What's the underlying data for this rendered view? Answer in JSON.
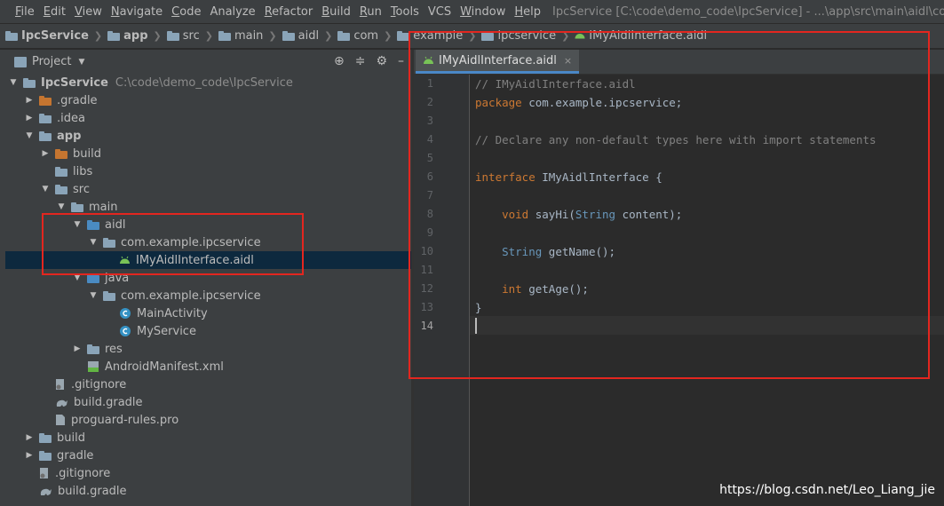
{
  "menubar": {
    "items": [
      {
        "label": "File",
        "mnemonic": "F",
        "rest": "ile"
      },
      {
        "label": "Edit",
        "mnemonic": "E",
        "rest": "dit"
      },
      {
        "label": "View",
        "mnemonic": "V",
        "rest": "iew"
      },
      {
        "label": "Navigate",
        "mnemonic": "N",
        "rest": "avigate"
      },
      {
        "label": "Code",
        "mnemonic": "C",
        "rest": "ode"
      },
      {
        "label": "Analyze",
        "mnemonic": "",
        "rest": "Analyze"
      },
      {
        "label": "Refactor",
        "mnemonic": "R",
        "rest": "efactor"
      },
      {
        "label": "Build",
        "mnemonic": "B",
        "rest": "uild"
      },
      {
        "label": "Run",
        "mnemonic": "R",
        "rest": "un"
      },
      {
        "label": "Tools",
        "mnemonic": "T",
        "rest": "ools"
      },
      {
        "label": "VCS",
        "mnemonic": "",
        "rest": "VCS"
      },
      {
        "label": "Window",
        "mnemonic": "W",
        "rest": "indow"
      },
      {
        "label": "Help",
        "mnemonic": "H",
        "rest": "elp"
      }
    ],
    "window_title": "IpcService [C:\\code\\demo_code\\IpcService] - ...\\app\\src\\main\\aidl\\com\\example"
  },
  "breadcrumbs": [
    {
      "label": "IpcService",
      "bold": true
    },
    {
      "label": "app",
      "bold": true
    },
    {
      "label": "src",
      "bold": false
    },
    {
      "label": "main",
      "bold": false
    },
    {
      "label": "aidl",
      "bold": false
    },
    {
      "label": "com",
      "bold": false
    },
    {
      "label": "example",
      "bold": false
    },
    {
      "label": "ipcservice",
      "bold": false
    },
    {
      "label": "IMyAidlInterface.aidl",
      "bold": false
    }
  ],
  "project_panel": {
    "title": "Project"
  },
  "tree": [
    {
      "label": "IpcService",
      "path": "C:\\code\\demo_code\\IpcService",
      "indent": 0,
      "arrow": "down",
      "icon": "module",
      "bold": true
    },
    {
      "label": ".gradle",
      "indent": 1,
      "arrow": "right",
      "icon": "folder-orange"
    },
    {
      "label": ".idea",
      "indent": 1,
      "arrow": "right",
      "icon": "folder"
    },
    {
      "label": "app",
      "indent": 1,
      "arrow": "down",
      "icon": "module",
      "bold": true
    },
    {
      "label": "build",
      "indent": 2,
      "arrow": "right",
      "icon": "folder-orange"
    },
    {
      "label": "libs",
      "indent": 2,
      "arrow": "",
      "icon": "folder"
    },
    {
      "label": "src",
      "indent": 2,
      "arrow": "down",
      "icon": "folder"
    },
    {
      "label": "main",
      "indent": 3,
      "arrow": "down",
      "icon": "folder"
    },
    {
      "label": "aidl",
      "indent": 4,
      "arrow": "down",
      "icon": "folder-blue"
    },
    {
      "label": "com.example.ipcservice",
      "indent": 5,
      "arrow": "down",
      "icon": "package"
    },
    {
      "label": "IMyAidlInterface.aidl",
      "indent": 6,
      "arrow": "",
      "icon": "android",
      "selected": true
    },
    {
      "label": "java",
      "indent": 4,
      "arrow": "down",
      "icon": "folder-blue"
    },
    {
      "label": "com.example.ipcservice",
      "indent": 5,
      "arrow": "down",
      "icon": "package"
    },
    {
      "label": "MainActivity",
      "indent": 6,
      "arrow": "",
      "icon": "class"
    },
    {
      "label": "MyService",
      "indent": 6,
      "arrow": "",
      "icon": "class"
    },
    {
      "label": "res",
      "indent": 4,
      "arrow": "right",
      "icon": "folder-res"
    },
    {
      "label": "AndroidManifest.xml",
      "indent": 4,
      "arrow": "",
      "icon": "manifest"
    },
    {
      "label": ".gitignore",
      "indent": 2,
      "arrow": "",
      "icon": "gitignore"
    },
    {
      "label": "build.gradle",
      "indent": 2,
      "arrow": "",
      "icon": "gradle"
    },
    {
      "label": "proguard-rules.pro",
      "indent": 2,
      "arrow": "",
      "icon": "file"
    },
    {
      "label": "build",
      "indent": 1,
      "arrow": "right",
      "icon": "folder"
    },
    {
      "label": "gradle",
      "indent": 1,
      "arrow": "right",
      "icon": "folder"
    },
    {
      "label": ".gitignore",
      "indent": 1,
      "arrow": "",
      "icon": "gitignore"
    },
    {
      "label": "build.gradle",
      "indent": 1,
      "arrow": "",
      "icon": "gradle"
    }
  ],
  "editor_tab": {
    "label": "IMyAidlInterface.aidl"
  },
  "code_lines": [
    [
      {
        "t": "// IMyAidlInterface.aidl",
        "c": "comment"
      }
    ],
    [
      {
        "t": "package",
        "c": "kw"
      },
      {
        "t": " com.example.ipcservice;",
        "c": ""
      }
    ],
    [],
    [
      {
        "t": "// Declare any non-default types here with import statements",
        "c": "comment"
      }
    ],
    [],
    [
      {
        "t": "interface",
        "c": "kw"
      },
      {
        "t": " IMyAidlInterface {",
        "c": ""
      }
    ],
    [],
    [
      {
        "t": "    ",
        "c": ""
      },
      {
        "t": "void",
        "c": "kw"
      },
      {
        "t": " sayHi(",
        "c": ""
      },
      {
        "t": "String",
        "c": "type"
      },
      {
        "t": " content);",
        "c": ""
      }
    ],
    [],
    [
      {
        "t": "    ",
        "c": ""
      },
      {
        "t": "String",
        "c": "type"
      },
      {
        "t": " getName();",
        "c": ""
      }
    ],
    [],
    [
      {
        "t": "    ",
        "c": ""
      },
      {
        "t": "int",
        "c": "kw"
      },
      {
        "t": " getAge();",
        "c": ""
      }
    ],
    [
      {
        "t": "}",
        "c": ""
      }
    ],
    []
  ],
  "line_numbers": [
    "1",
    "2",
    "3",
    "4",
    "5",
    "6",
    "7",
    "8",
    "9",
    "10",
    "11",
    "12",
    "13",
    "14"
  ],
  "current_line": "14",
  "watermark": "https://blog.csdn.net/Leo_Liang_jie",
  "colors": {
    "highlight": "#e3261f",
    "android": "#78c257",
    "selection": "#0d293e"
  }
}
